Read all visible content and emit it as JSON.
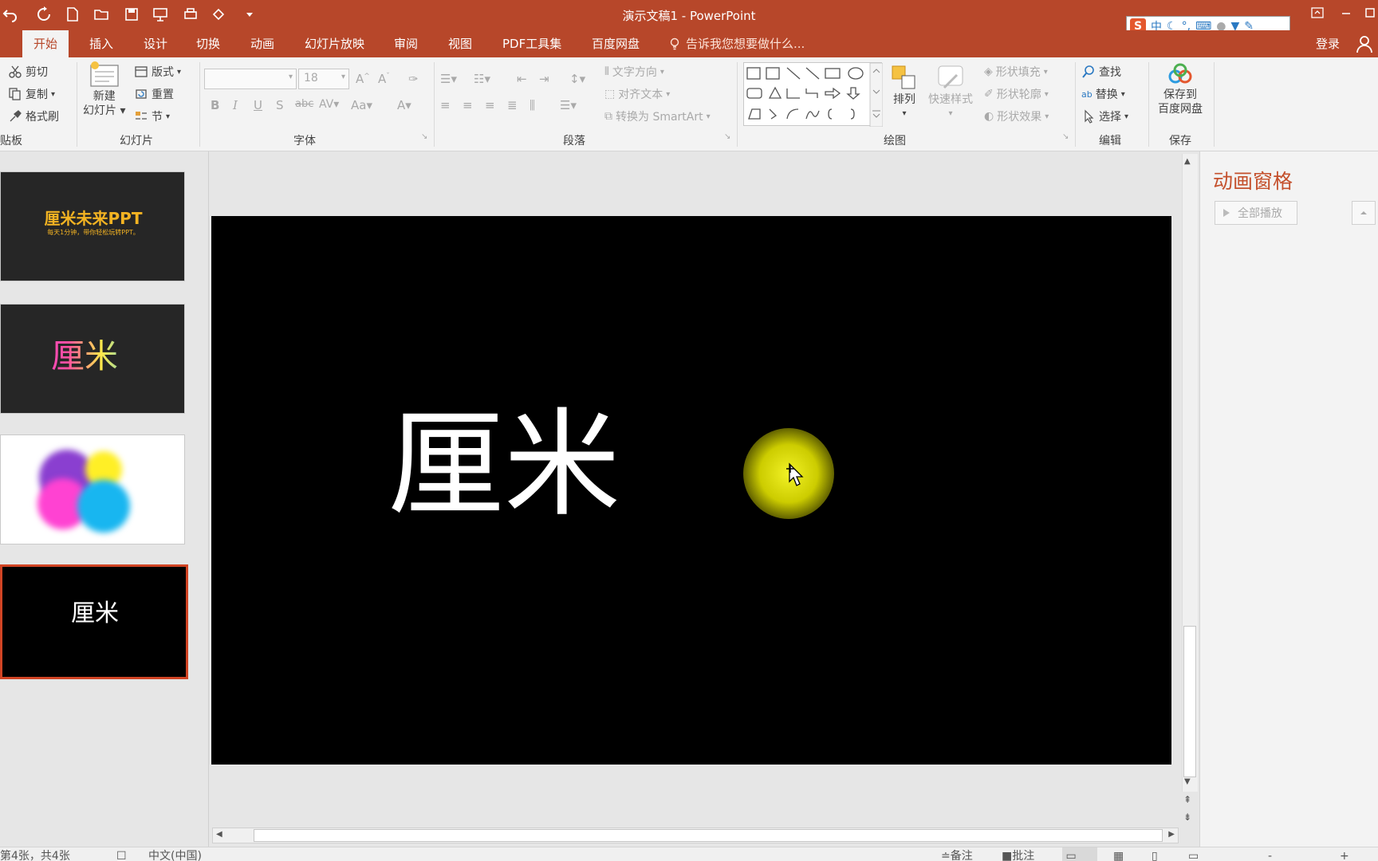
{
  "window": {
    "title": "演示文稿1 - PowerPoint",
    "accent": "#b7472a"
  },
  "ime": {
    "label": "中"
  },
  "tabs": [
    {
      "label": "开始",
      "active": true
    },
    {
      "label": "插入"
    },
    {
      "label": "设计"
    },
    {
      "label": "切换"
    },
    {
      "label": "动画"
    },
    {
      "label": "幻灯片放映"
    },
    {
      "label": "审阅"
    },
    {
      "label": "视图"
    },
    {
      "label": "PDF工具集"
    },
    {
      "label": "百度网盘"
    }
  ],
  "tell_me": "告诉我您想要做什么...",
  "login": "登录",
  "ribbon": {
    "clipboard": {
      "cut": "剪切",
      "copy": "复制",
      "format_painter": "格式刷",
      "label": "贴板"
    },
    "slides": {
      "new_slide_1": "新建",
      "new_slide_2": "幻灯片",
      "layout": "版式",
      "reset": "重置",
      "section": "节",
      "label": "幻灯片"
    },
    "font": {
      "size": "18",
      "label": "字体"
    },
    "paragraph": {
      "text_direction": "文字方向",
      "align_text": "对齐文本",
      "smartart": "转换为 SmartArt",
      "label": "段落"
    },
    "drawing": {
      "arrange": "排列",
      "quick_styles": "快速样式",
      "shape_fill": "形状填充",
      "shape_outline": "形状轮廓",
      "shape_effects": "形状效果",
      "label": "绘图"
    },
    "editing": {
      "find": "查找",
      "replace": "替换",
      "select": "选择",
      "label": "编辑"
    },
    "save": {
      "save_to_1": "保存到",
      "save_to_2": "百度网盘",
      "label": "保存"
    }
  },
  "thumbnails": [
    {
      "title": "厘米未来PPT",
      "subtitle": "每天1分钟，带你轻松玩转PPT。"
    },
    {
      "title": "厘米"
    },
    {
      "title": ""
    },
    {
      "title": "厘米"
    }
  ],
  "slide": {
    "title": "厘米"
  },
  "animation_pane": {
    "title": "动画窗格",
    "play_all": "全部播放"
  },
  "status": {
    "slide_info": "第4张，共4张",
    "language": "中文(中国)",
    "notes": "备注",
    "comments": "批注"
  }
}
